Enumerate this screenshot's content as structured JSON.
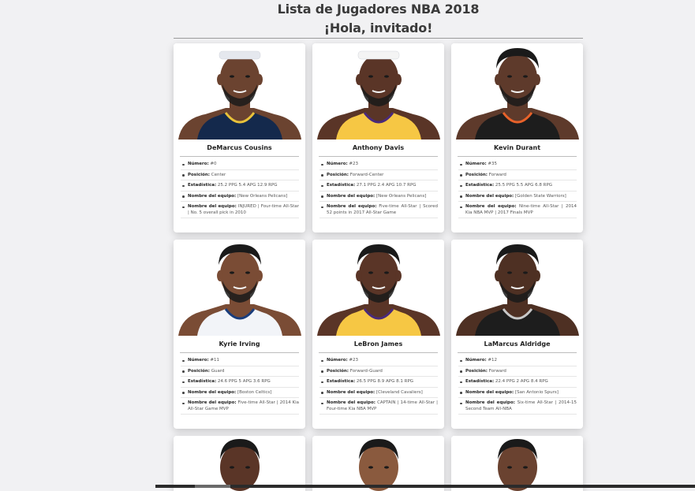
{
  "header": {
    "title": "Lista de Jugadores NBA 2018",
    "greeting": "¡Hola, invitado!"
  },
  "labels": {
    "number": "Número:",
    "position": "Posición:",
    "stats": "Estadística:",
    "team": "Nombre del equipo:",
    "team2": "Nombre del equipo:"
  },
  "players": [
    {
      "name": "DeMarcus Cousins",
      "number": "#0",
      "position": "Center",
      "stats": "25.2 PPG 5.4 APG 12.9 RPG",
      "team": "[New Orleans Pelicans]",
      "notes": "INJURED | Four-time All-Star | No. 5 overall pick in 2010",
      "jersey": "#14294c",
      "jersey_accent": "#e8c23a",
      "skin": "#6b4330",
      "headband": "#e5e8ee"
    },
    {
      "name": "Anthony Davis",
      "number": "#23",
      "position": "Forward-Center",
      "stats": "27.1 PPG 2.4 APG 10.7 RPG",
      "team": "[New Orleans Pelicans]",
      "notes": "Five-time All-Star | Scored 52 points in 2017 All-Star Game",
      "jersey": "#f6c744",
      "jersey_accent": "#4a2a7a",
      "skin": "#5a3527",
      "headband": "#f4f4f4"
    },
    {
      "name": "Kevin Durant",
      "number": "#35",
      "position": "Forward",
      "stats": "25.5 PPG 5.5 APG 6.8 RPG",
      "team": "[Golden State Warriors]",
      "notes": "Nine-time All-Star | 2014 Kia NBA MVP | 2017 Finals MVP",
      "jersey": "#1d1d1d",
      "jersey_accent": "#e8622a",
      "skin": "#5e3a2b",
      "headband": ""
    },
    {
      "name": "Kyrie Irving",
      "number": "#11",
      "position": "Guard",
      "stats": "24.6 PPG 5 APG 3.6 RPG",
      "team": "[Boston Celtics]",
      "notes": "Five-time All-Star | 2014 Kia All-Star Game MVP",
      "jersey": "#f2f4f8",
      "jersey_accent": "#1a3d7c",
      "skin": "#7a4c35",
      "headband": ""
    },
    {
      "name": "LeBron James",
      "number": "#23",
      "position": "Forward-Guard",
      "stats": "26.5 PPG 8.9 APG 8.1 RPG",
      "team": "[Cleveland Cavaliers]",
      "notes": "CAPTAIN | 14-time All-Star | Four-time Kia NBA MVP",
      "jersey": "#f6c744",
      "jersey_accent": "#4a2a7a",
      "skin": "#5a3527",
      "headband": ""
    },
    {
      "name": "LaMarcus Aldridge",
      "number": "#12",
      "position": "Forward",
      "stats": "22.4 PPG 2 APG 8.4 RPG",
      "team": "[San Antonio Spurs]",
      "notes": "Six-time All-Star | 2014-15 Second Team All-NBA",
      "jersey": "#1d1d1d",
      "jersey_accent": "#c8c8c8",
      "skin": "#4e3023",
      "headband": ""
    }
  ],
  "partial_players": [
    {
      "skin": "#5a3527"
    },
    {
      "skin": "#8a5a3e"
    },
    {
      "skin": "#6a4230"
    }
  ]
}
